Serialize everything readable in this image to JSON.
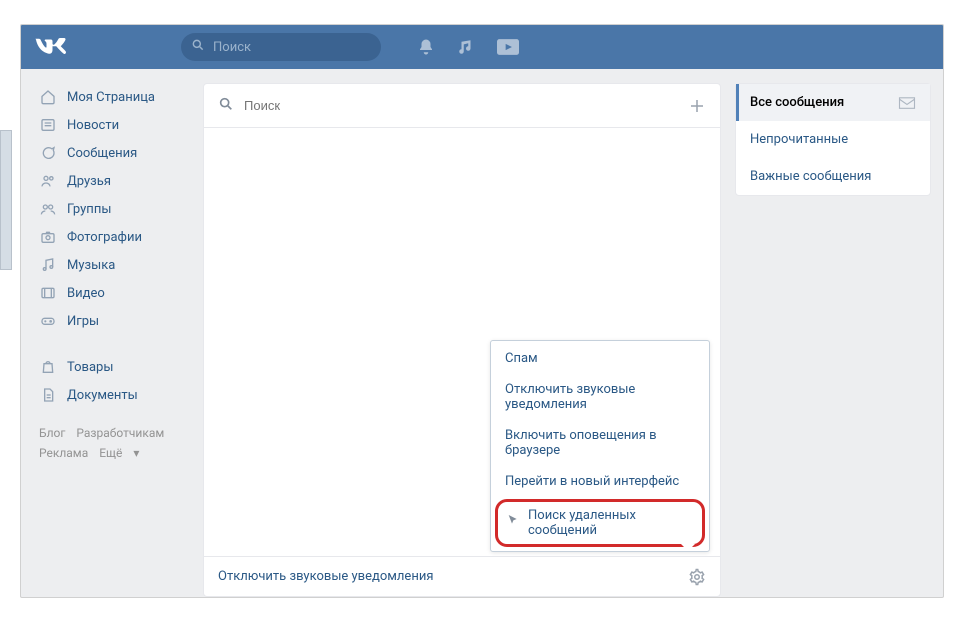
{
  "top": {
    "search_placeholder": "Поиск"
  },
  "sidebar": {
    "items": [
      {
        "label": "Моя Страница"
      },
      {
        "label": "Новости"
      },
      {
        "label": "Сообщения"
      },
      {
        "label": "Друзья"
      },
      {
        "label": "Группы"
      },
      {
        "label": "Фотографии"
      },
      {
        "label": "Музыка"
      },
      {
        "label": "Видео"
      },
      {
        "label": "Игры"
      }
    ],
    "items2": [
      {
        "label": "Товары"
      },
      {
        "label": "Документы"
      }
    ],
    "footer": {
      "blog": "Блог",
      "devs": "Разработчикам",
      "ads": "Реклама",
      "more": "Ещё"
    }
  },
  "messages": {
    "search_placeholder": "Поиск",
    "footer_action": "Отключить звуковые уведомления"
  },
  "filters": {
    "all": "Все сообщения",
    "unread": "Непрочитанные",
    "important": "Важные сообщения"
  },
  "popup": {
    "spam": "Спам",
    "mute": "Отключить звуковые уведомления",
    "browser_notify": "Включить оповещения в браузере",
    "new_ui": "Перейти в новый интерфейс",
    "find_deleted": "Поиск удаленных сообщений"
  }
}
